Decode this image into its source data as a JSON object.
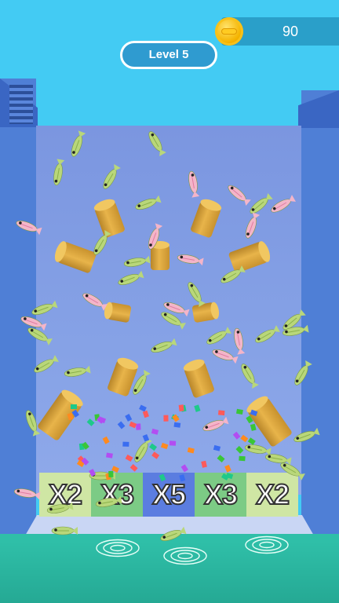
{
  "hud": {
    "coins": "90",
    "level_label": "Level 5"
  },
  "multipliers": [
    {
      "label": "X2",
      "color": "#cfe6a4"
    },
    {
      "label": "X3",
      "color": "#7ccb85"
    },
    {
      "label": "X5",
      "color": "#5b7de0"
    },
    {
      "label": "X3",
      "color": "#7ccb85"
    },
    {
      "label": "X2",
      "color": "#cfe6a4"
    }
  ],
  "colors": {
    "fish_green": "#b9d77a",
    "fish_pink": "#f3b5c9",
    "peg": "#dba33b",
    "water": "#2fbfa8"
  }
}
